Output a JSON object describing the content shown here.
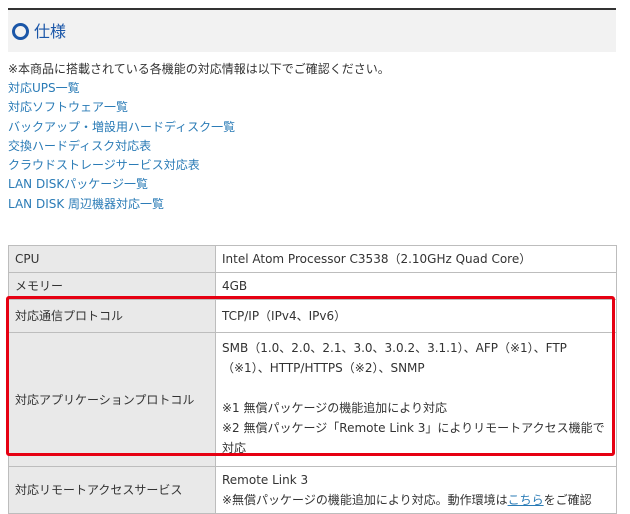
{
  "section": {
    "title": "仕様"
  },
  "note": "※本商品に搭載されている各機能の対応情報は以下でご確認ください。",
  "links": [
    "対応UPS一覧",
    "対応ソフトウェア一覧",
    "バックアップ・増設用ハードディスク一覧",
    "交換ハードディスク対応表",
    "クラウドストレージサービス対応表",
    "LAN DISKパッケージ一覧",
    "LAN DISK 周辺機器対応一覧"
  ],
  "spec": {
    "cpu": {
      "label": "CPU",
      "value": "Intel Atom Processor C3538（2.10GHz Quad Core）"
    },
    "memory": {
      "label": "メモリー",
      "value": "4GB"
    },
    "comm_protocol": {
      "label": "対応通信プロトコル",
      "value": "TCP/IP（IPv4、IPv6）"
    },
    "app_protocol": {
      "label": "対応アプリケーションプロトコル",
      "line1": "SMB（1.0、2.0、2.1、3.0、3.0.2、3.1.1）、AFP（※1）、FTP",
      "line2": "（※1）、HTTP/HTTPS（※2）、SNMP",
      "note1": "※1 無償パッケージの機能追加により対応",
      "note2a": "※2 無償パッケージ「Remote Link 3」によりリモートアクセス機能で",
      "note2b": "対応"
    },
    "remote_access": {
      "label": "対応リモートアクセスサービス",
      "line1": "Remote Link 3",
      "line2_prefix": "※無償パッケージの機能追加により対応。動作環境は",
      "line2_link": "こちら",
      "line2_suffix": "をご確認"
    }
  },
  "highlight_color": "#e60012",
  "icons": {
    "heading_bullet": "circle-bullet-icon"
  }
}
